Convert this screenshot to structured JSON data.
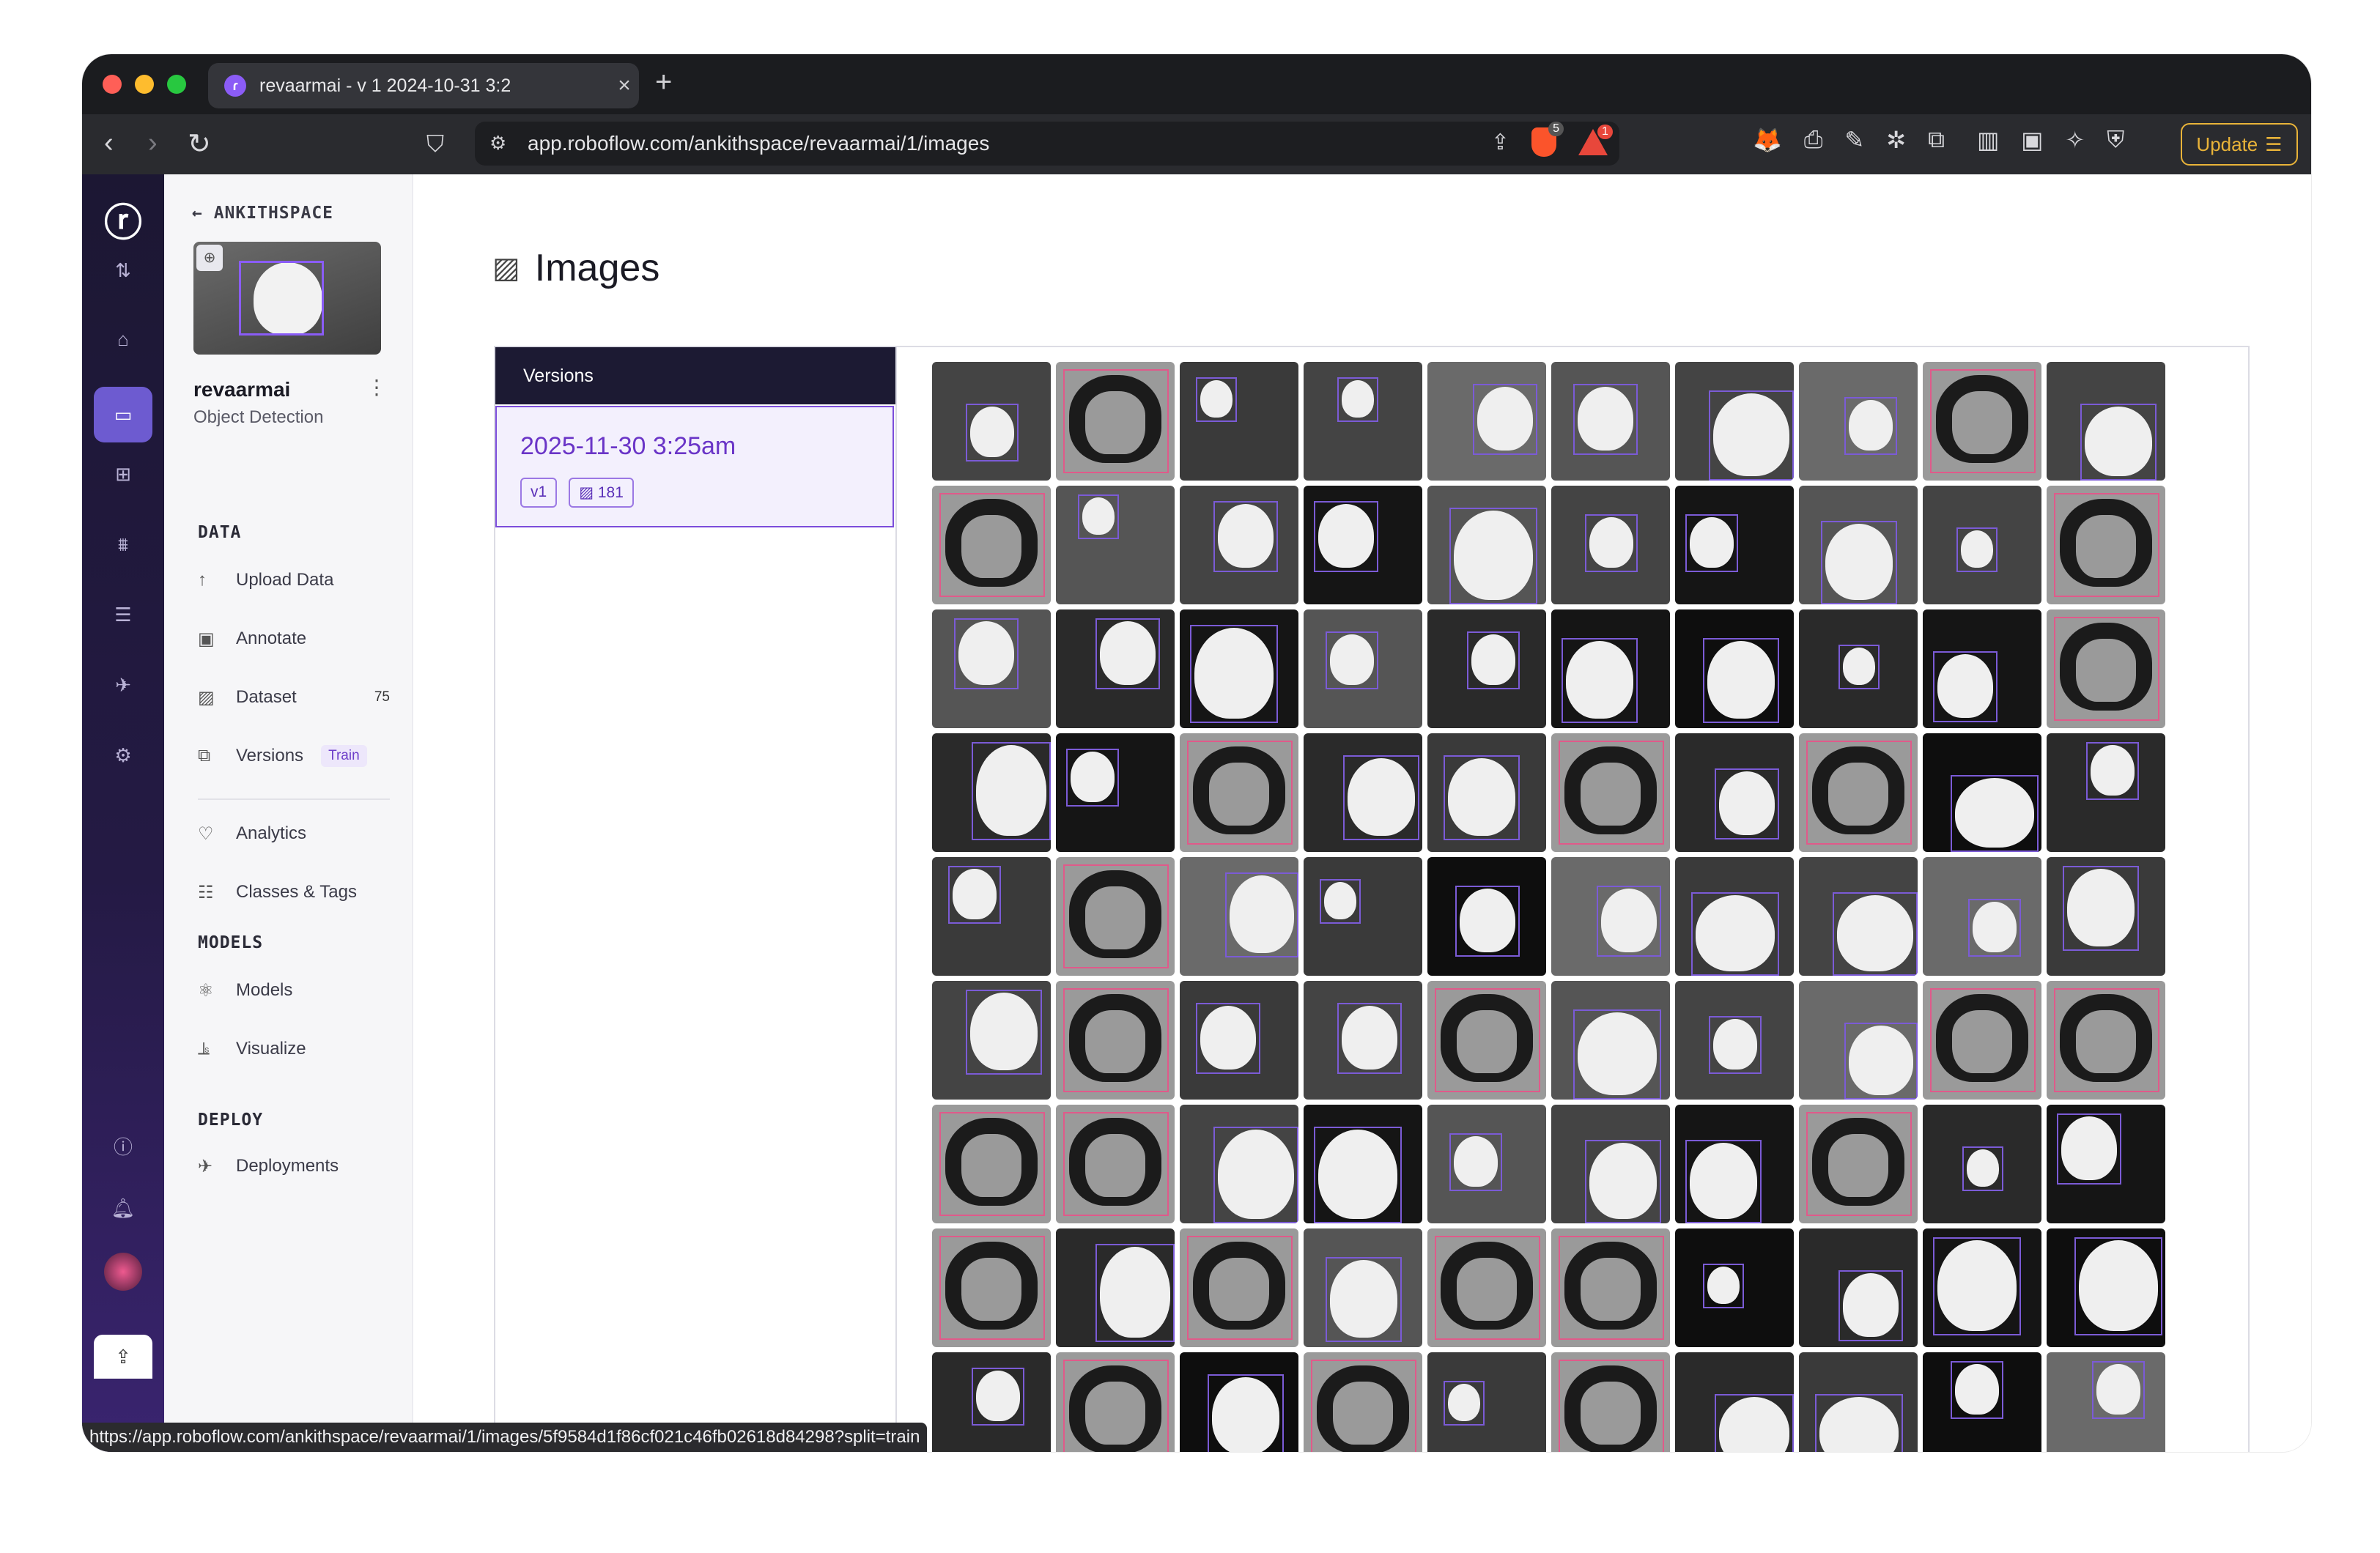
{
  "browser": {
    "tab_title": "revaarmai - v 1 2024-10-31 3:2",
    "url": "app.roboflow.com/ankithspace/revaarmai/1/images",
    "brave_count": "5",
    "alert_count": "1",
    "update_label": "Update",
    "status_url": "https://app.roboflow.com/ankithspace/revaarmai/1/images/5f9584d1f86cf021c46fb02618d84298?split=train"
  },
  "sidebar": {
    "workspace": "ANKITHSPACE",
    "project_name": "revaarmai",
    "project_type": "Object Detection",
    "sections": {
      "data": "DATA",
      "models": "MODELS",
      "deploy": "DEPLOY"
    },
    "items": {
      "upload": "Upload Data",
      "annotate": "Annotate",
      "dataset": "Dataset",
      "dataset_count": "75",
      "versions": "Versions",
      "versions_badge": "Train",
      "analytics": "Analytics",
      "classes": "Classes & Tags",
      "models": "Models",
      "visualize": "Visualize",
      "deployments": "Deployments"
    }
  },
  "main": {
    "title": "Images",
    "versions_header": "Versions",
    "version": {
      "date": "2025-11-30 3:25am",
      "tag": "v1",
      "image_count": "181"
    }
  },
  "grid": {
    "columns": 10,
    "rows": 9,
    "cells": "mouse,headphones,mouse,mouse,mouse,mouse,mouse,mouse,headphones,mouse,headphones,mouse,mouse,mouse,mouse,mouse,mouse,mouse,mouse,headphones,mouse,mouse,mouse,mouse,mouse,mouse,mouse,mouse,mouse,headphones,mouse,mouse,headphones,mouse,mouse,headphones,mouse,headphones,mouse,mouse,mouse,headphones,mouse,mouse,mouse,mouse,mouse,mouse,mouse,mouse,mouse,headphones,mouse,mouse,headphones,mouse,mouse,mouse,headphones,headphones,headphones,headphones,mouse,mouse,mouse,mouse,mouse,headphones,mouse,mouse,headphones,mouse,headphones,mouse,headphones,headphones,mouse,mouse,mouse,mouse,mouse,headphones,mouse,headphones,mouse,headphones,mouse,mouse,mouse,mouse"
  },
  "colors": {
    "accent": "#6a35c7",
    "rail_top": "#1c1733",
    "versions_header_bg": "#1c1a33",
    "bbox_purple": "#7b5bd6",
    "bbox_pink": "#e05a8a"
  }
}
